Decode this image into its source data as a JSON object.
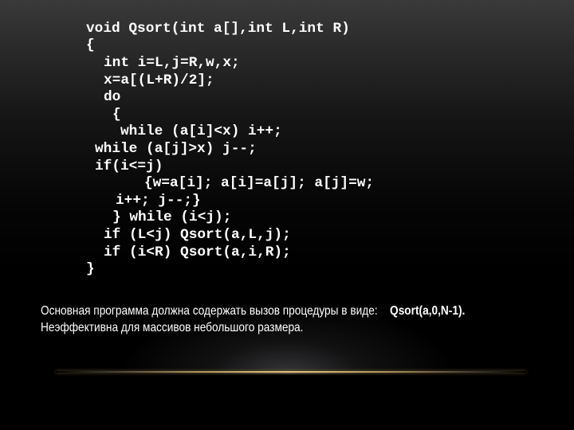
{
  "code": {
    "lines": [
      "void Qsort(int a[],int L,int R)",
      "{",
      "int i=L,j=R,w,x;",
      "x=a[(L+R)/2];",
      "do",
      "{",
      "while (a[i]<x) i++;",
      "while (a[j]>x) j--;",
      "if(i<=j)",
      "{w=a[i]; a[i]=a[j]; a[j]=w;",
      "i++; j--;}",
      "} while (i<j);",
      "if (L<j) Qsort(a,L,j);",
      "if (i<R) Qsort(a,i,R);",
      "}"
    ]
  },
  "notes": {
    "line1_text": "Основная программа должна содержать вызов процедуры в виде:",
    "line1_call": "Qsort(a,0,N-1).",
    "line2_text": "Неэффективна для массивов небольшого размера."
  },
  "colors": {
    "text": "#ffffff",
    "background_top": "#3a3a3a",
    "background_bottom": "#000000",
    "accent_line": "#e1c378"
  }
}
